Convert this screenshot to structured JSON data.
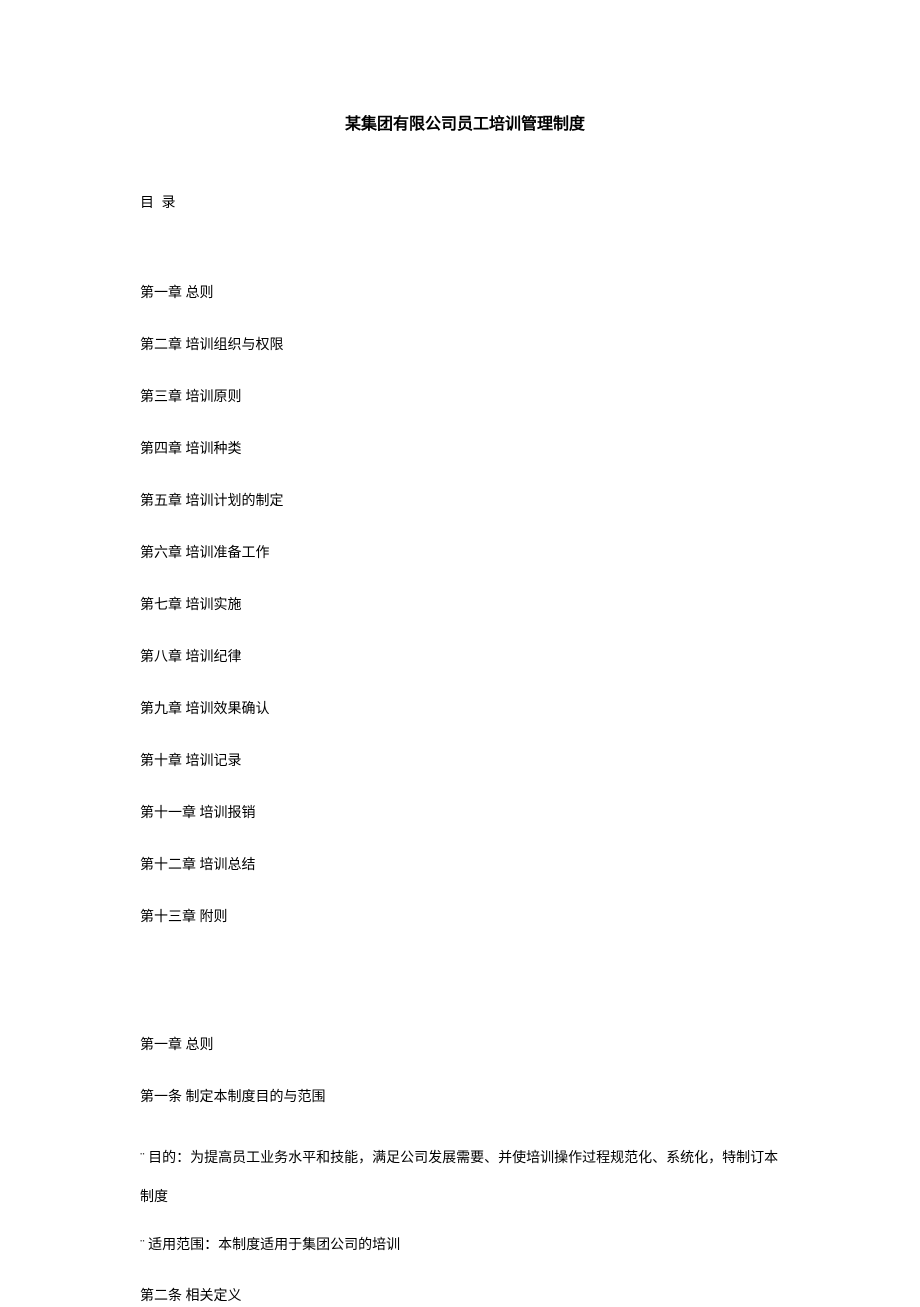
{
  "title": "某集团有限公司员工培训管理制度",
  "toc": {
    "header": "目 录",
    "items": [
      "第一章  总则",
      "第二章  培训组织与权限",
      "第三章  培训原则",
      "第四章  培训种类",
      "第五章  培训计划的制定",
      "第六章  培训准备工作",
      "第七章  培训实施",
      "第八章  培训纪律",
      "第九章  培训效果确认",
      "第十章  培训记录",
      "第十一章  培训报销",
      "第十二章  培训总结",
      "第十三章  附则"
    ]
  },
  "body": {
    "lines": [
      "第一章  总则",
      "第一条  制定本制度目的与范围",
      "¨ 目的：为提高员工业务水平和技能，满足公司发展需要、并使培训操作过程规范化、系统化，特制订本制度",
      "¨ 适用范围：本制度适用于集团公司的培训",
      "第二条  相关定义"
    ]
  }
}
